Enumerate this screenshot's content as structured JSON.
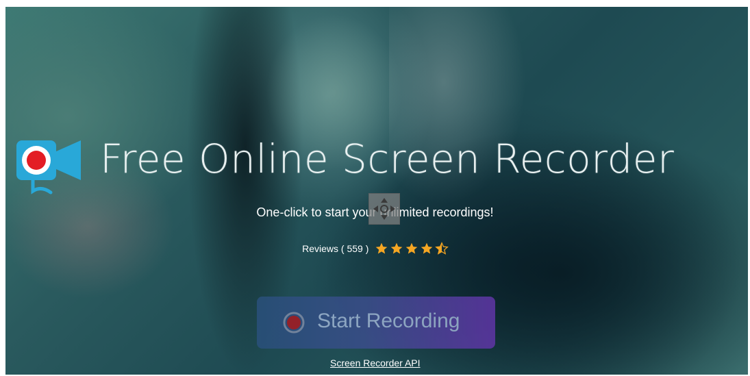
{
  "hero": {
    "title": "Free Online Screen Recorder",
    "subtitle": "One-click to start your unlimited recordings!",
    "reviews_label": "Reviews ( 559 )",
    "rating_stars": 4.5,
    "rating_max": 5,
    "star_color": "#f5a623"
  },
  "actions": {
    "start_label": "Start Recording",
    "api_link": "Screen Recorder API"
  },
  "icons": {
    "logo": "camera-record-icon",
    "record": "record-dot-icon",
    "move": "move-handle-icon"
  },
  "colors": {
    "logo_blue": "#29a8d8",
    "record_red": "#e31d24",
    "button_start": "#29507a",
    "button_end": "#5e35a4"
  }
}
